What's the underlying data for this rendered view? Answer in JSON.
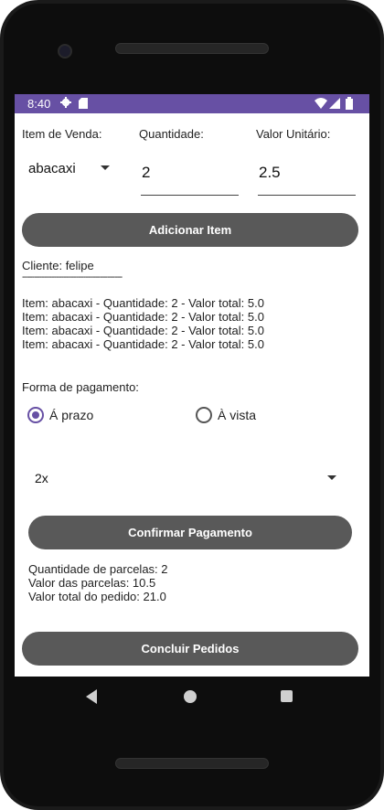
{
  "status_bar": {
    "time": "8:40",
    "icons": [
      "gear-icon",
      "sd-card-icon",
      "wifi-icon",
      "signal-icon",
      "battery-icon"
    ]
  },
  "form": {
    "item_label": "Item de Venda:",
    "quantity_label": "Quantidade:",
    "unit_value_label": "Valor Unitário:",
    "item_selected": "abacaxi",
    "quantity_value": "2",
    "unit_value": "2.5",
    "add_button": "Adicionar Item"
  },
  "order": {
    "client": "Cliente: felipe",
    "divider": "-----------------------------------------",
    "items": [
      "Item: abacaxi - Quantidade: 2 - Valor total: 5.0",
      "Item: abacaxi - Quantidade: 2 - Valor total: 5.0",
      "Item: abacaxi - Quantidade: 2 - Valor total: 5.0",
      "Item: abacaxi - Quantidade: 2 - Valor total: 5.0"
    ]
  },
  "payment": {
    "label": "Forma de pagamento:",
    "option_installment": "Á prazo",
    "option_cash": "À vista",
    "selected_option": "Á prazo",
    "installments_selected": "2x",
    "confirm_button": "Confirmar Pagamento",
    "summary": [
      "Quantidade de parcelas: 2",
      "Valor das parcelas: 10.5",
      "Valor total do pedido: 21.0"
    ]
  },
  "finish_button": "Concluir Pedidos",
  "colors": {
    "accent": "#6750a4",
    "button": "#595959",
    "status_bar": "#6750a4"
  }
}
